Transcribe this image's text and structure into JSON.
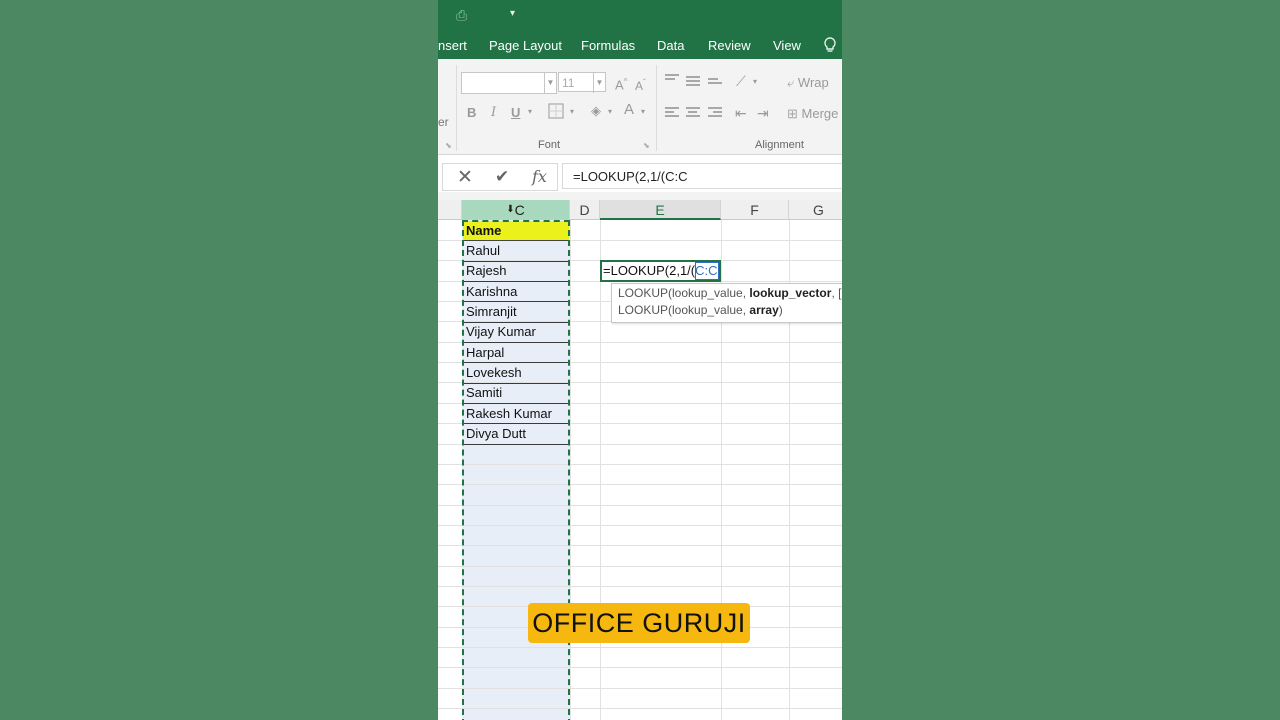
{
  "colors": {
    "background": "#4c8862",
    "excel_green": "#217346",
    "ribbon": "#f3f3f3",
    "header_fill": "#ebf21b",
    "column_selected": "#e8eef8",
    "watermark_bg": "#f6b80f",
    "reference_blue": "#2e6fc3"
  },
  "titlebar": {
    "quick_access_icon": "print-preview-icon",
    "customize_icon": "chevron-down-icon"
  },
  "ribbon_tabs": [
    "nsert",
    "Page Layout",
    "Formulas",
    "Data",
    "Review",
    "View"
  ],
  "ribbon": {
    "cutoff_label": "er",
    "font_size_value": "11",
    "font_group_label": "Font",
    "alignment_group_label": "Alignment",
    "wrap_label": "Wrap",
    "merge_label": "Merge",
    "bold_glyph": "B",
    "italic_glyph": "I",
    "underline_glyph": "U",
    "font_color_glyph": "A",
    "grow_glyph": "A",
    "shrink_glyph": "A"
  },
  "formula_bar": {
    "cancel_glyph": "✕",
    "enter_glyph": "✔",
    "fx_glyph": "fx",
    "formula": "=LOOKUP(2,1/(C:C"
  },
  "columns": [
    {
      "label": "C",
      "state": "selected"
    },
    {
      "label": "D",
      "state": "normal"
    },
    {
      "label": "E",
      "state": "active"
    },
    {
      "label": "F",
      "state": "normal"
    },
    {
      "label": "G",
      "state": "normal"
    }
  ],
  "cells": {
    "header": "Name",
    "names": [
      "Rahul",
      "Rajesh",
      "Karishna",
      "Simranjit",
      "Vijay Kumar",
      "Harpal",
      "Lovekesh",
      "Samiti",
      "Rakesh Kumar",
      "Divya Dutt"
    ]
  },
  "edit_cell": {
    "prefix": "=LOOKUP(2,1/(",
    "reference": "C:C"
  },
  "tooltip": {
    "line1_prefix": "LOOKUP(lookup_value, ",
    "line1_bold": "lookup_vector",
    "line1_suffix": ", [",
    "line2_prefix": "LOOKUP(lookup_value, ",
    "line2_bold": "array",
    "line2_suffix": ")"
  },
  "watermark": "OFFICE GURUJI"
}
